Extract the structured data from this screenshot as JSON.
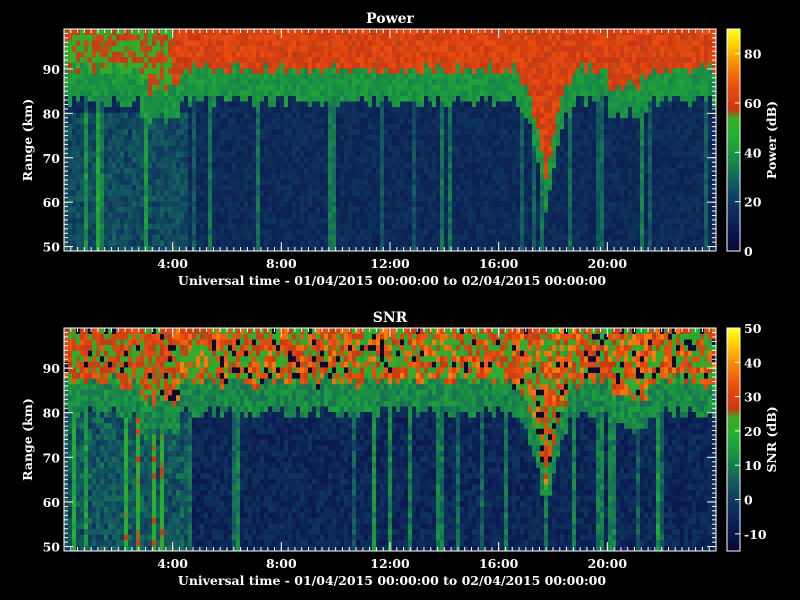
{
  "colors": {
    "background": "#000000",
    "foreground": "#ffffff",
    "colormap": [
      "#0a0a3c",
      "#0f2d5a",
      "#14505a",
      "#198c46",
      "#28b432",
      "#c83214",
      "#f05a0a",
      "#ffc800",
      "#ffff00"
    ]
  },
  "chart_data": [
    {
      "type": "heatmap",
      "title": "Power",
      "xlabel": "Universal time - 01/04/2015 00:00:00 to 02/04/2015 00:00:00",
      "ylabel": "Range (km)",
      "x_range_hours": [
        0,
        24
      ],
      "xticks": [
        4,
        8,
        12,
        16,
        20
      ],
      "xtick_labels": [
        "4:00",
        "8:00",
        "12:00",
        "16:00",
        "20:00"
      ],
      "ylim": [
        49,
        99
      ],
      "yticks": [
        50,
        60,
        70,
        80,
        90
      ],
      "yticks_labels": [
        "50",
        "60",
        "70",
        "80",
        "90"
      ],
      "colorbar": {
        "label": "Power (dB)",
        "range": [
          0,
          90
        ],
        "ticks": [
          0,
          20,
          40,
          60,
          80
        ],
        "tick_labels": [
          "0",
          "20",
          "40",
          "60",
          "80"
        ]
      },
      "approx_field": {
        "description_values": "approximate values read from the colour scale",
        "upper_layer_level_db": 62,
        "upper_layer_base_km": 87,
        "lower_background_db": 15,
        "transition_band_db": 40,
        "descending_feature_hours": [
          17.0,
          18.5
        ],
        "descending_feature_min_km": 62
      }
    },
    {
      "type": "heatmap",
      "title": "SNR",
      "xlabel": "Universal time - 01/04/2015 00:00:00 to 02/04/2015 00:00:00",
      "ylabel": "Range (km)",
      "x_range_hours": [
        0,
        24
      ],
      "xticks": [
        4,
        8,
        12,
        16,
        20
      ],
      "xtick_labels": [
        "4:00",
        "8:00",
        "12:00",
        "16:00",
        "20:00"
      ],
      "ylim": [
        49,
        99
      ],
      "yticks": [
        50,
        60,
        70,
        80,
        90
      ],
      "yticks_labels": [
        "50",
        "60",
        "70",
        "80",
        "90"
      ],
      "colorbar": {
        "label": "SNR (dB)",
        "range": [
          -15,
          50
        ],
        "ticks": [
          -10,
          0,
          10,
          20,
          30,
          40,
          50
        ],
        "tick_labels": [
          "-10",
          "0",
          "10",
          "20",
          "30",
          "40",
          "50"
        ]
      },
      "approx_field": {
        "upper_layer_level_db": 28,
        "upper_layer_base_km": 84,
        "lower_background_db": -5,
        "transition_band_db": 12,
        "descending_feature_hours": [
          17.0,
          18.5
        ],
        "descending_feature_min_km": 60
      }
    }
  ]
}
